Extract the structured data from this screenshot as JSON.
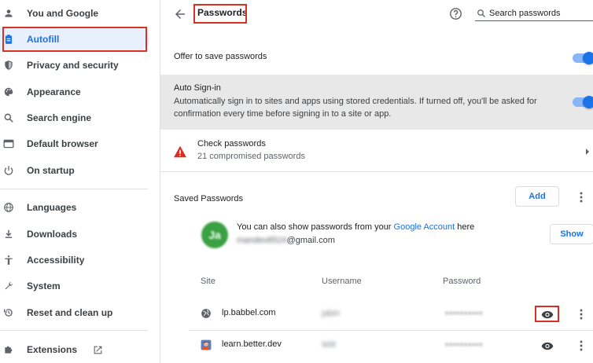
{
  "sidebar": {
    "items": [
      {
        "label": "You and Google",
        "icon": "person-icon"
      },
      {
        "label": "Autofill",
        "icon": "clipboard-icon"
      },
      {
        "label": "Privacy and security",
        "icon": "shield-icon"
      },
      {
        "label": "Appearance",
        "icon": "palette-icon"
      },
      {
        "label": "Search engine",
        "icon": "search-icon"
      },
      {
        "label": "Default browser",
        "icon": "browser-icon"
      },
      {
        "label": "On startup",
        "icon": "power-icon"
      },
      {
        "label": "Languages",
        "icon": "globe-icon"
      },
      {
        "label": "Downloads",
        "icon": "download-icon"
      },
      {
        "label": "Accessibility",
        "icon": "accessibility-icon"
      },
      {
        "label": "System",
        "icon": "wrench-icon"
      },
      {
        "label": "Reset and clean up",
        "icon": "restore-icon"
      },
      {
        "label": "Extensions",
        "icon": "puzzle-icon"
      }
    ],
    "active": "Autofill"
  },
  "header": {
    "title": "Passwords",
    "search_placeholder": "Search passwords"
  },
  "offer_to_save": {
    "label": "Offer to save passwords",
    "enabled": true
  },
  "auto_signin": {
    "title": "Auto Sign-in",
    "description": "Automatically sign in to sites and apps using stored credentials. If turned off, you'll be asked for confirmation every time before signing in to a site or app.",
    "enabled": true
  },
  "check_passwords": {
    "title": "Check passwords",
    "subtitle": "21 compromised passwords"
  },
  "saved_passwords": {
    "heading": "Saved Passwords",
    "add_label": "Add",
    "account_prefix": "You can also show passwords from your ",
    "account_link": "Google Account",
    "account_suffix": " here",
    "avatar_initials": "Ja",
    "email_hidden": "mandev8524",
    "email_domain": "@gmail.com",
    "show_label": "Show",
    "columns": {
      "site": "Site",
      "username": "Username",
      "password": "Password"
    },
    "rows": [
      {
        "site": "lp.babbel.com",
        "username": "jabin",
        "password": "••••••••••"
      },
      {
        "site": "learn.better.dev",
        "username": "Will",
        "password": "••••••••••"
      }
    ]
  },
  "colors": {
    "accent": "#1a73e8",
    "highlight_border": "#d93025",
    "warning": "#d93025"
  }
}
